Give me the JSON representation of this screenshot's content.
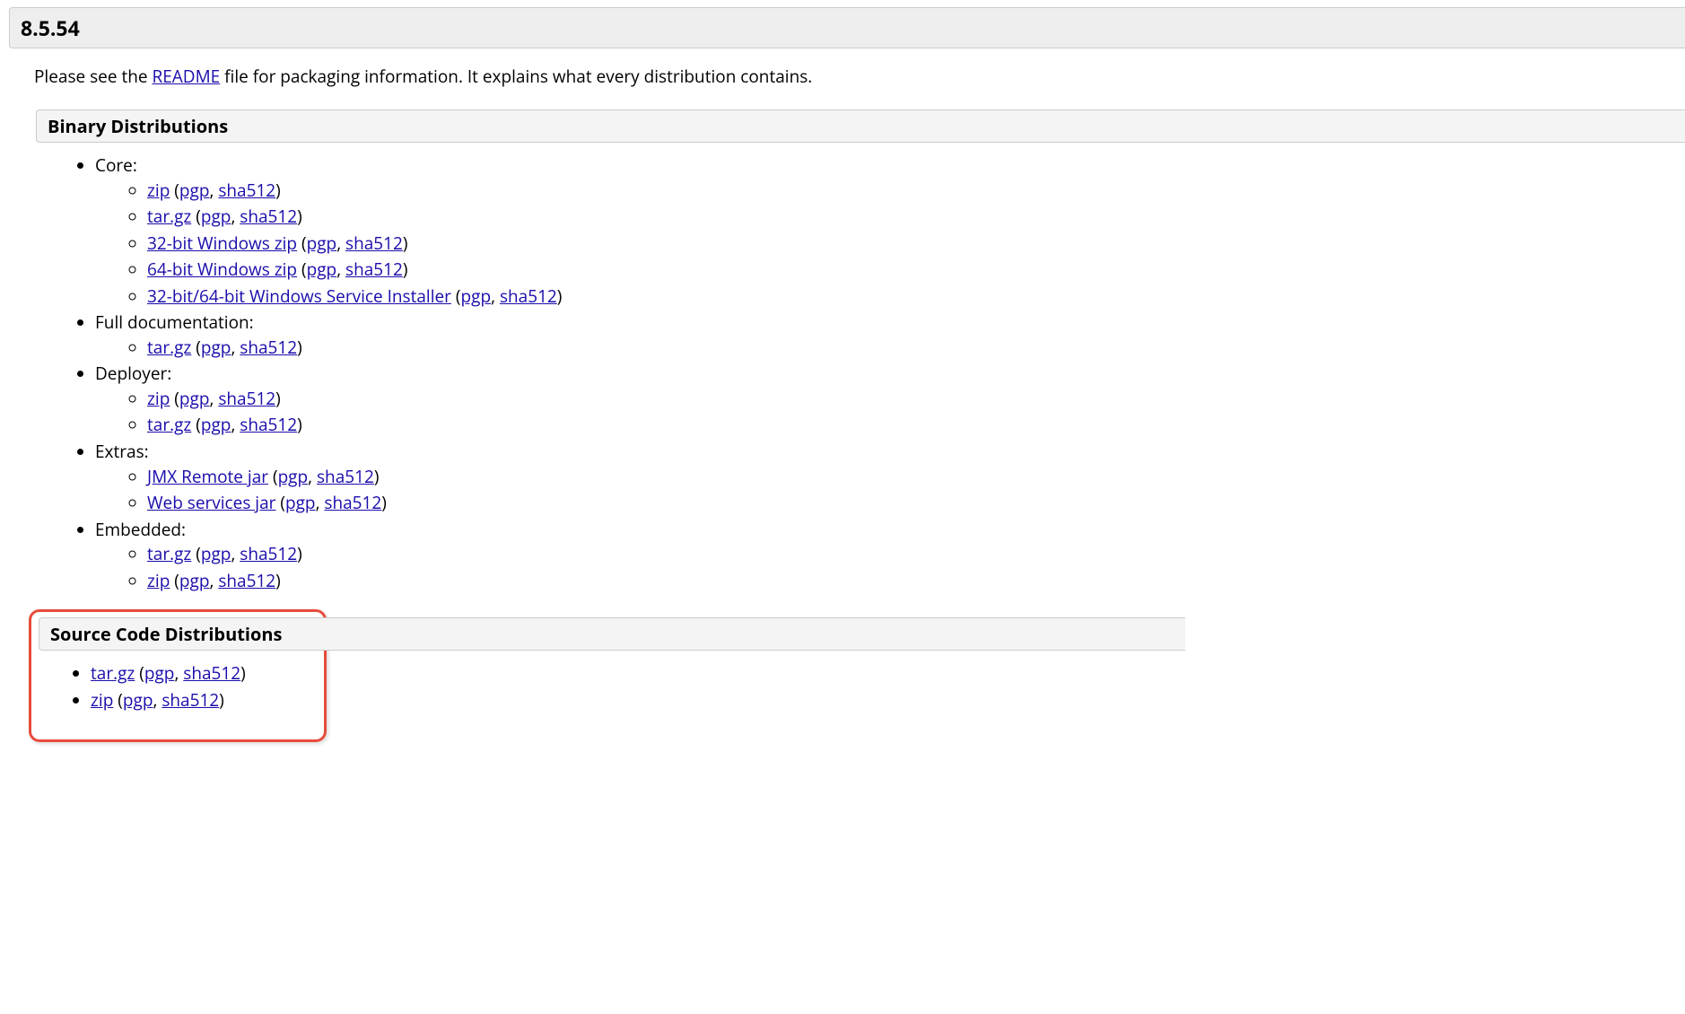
{
  "version_title": "8.5.54",
  "intro_pre": "Please see the ",
  "intro_link": "README",
  "intro_post": " file for packaging information. It explains what every distribution contains.",
  "binary_section_title": "Binary Distributions",
  "source_section_title": "Source Code Distributions",
  "labels": {
    "core": "Core:",
    "full_doc": "Full documentation:",
    "deployer": "Deployer:",
    "extras": "Extras:",
    "embedded": "Embedded:",
    "zip": "zip",
    "targz": "tar.gz",
    "win32zip": "32-bit Windows zip",
    "win64zip": "64-bit Windows zip",
    "win_service_installer": "32-bit/64-bit Windows Service Installer",
    "jmx_remote_jar": "JMX Remote jar",
    "web_services_jar": "Web services jar",
    "pgp": "pgp",
    "sha512": "sha512"
  }
}
